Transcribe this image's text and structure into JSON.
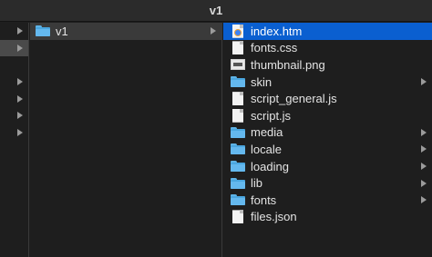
{
  "window": {
    "title": "v1"
  },
  "column1": {
    "rows": 12,
    "arrow_rows": [
      0,
      1,
      3,
      4,
      5,
      6
    ]
  },
  "column2": {
    "items": [
      {
        "name": "v1",
        "type": "folder",
        "selected": true,
        "has_children": true
      }
    ]
  },
  "column3": {
    "items": [
      {
        "name": "index.htm",
        "type": "html",
        "selected": true,
        "has_children": false
      },
      {
        "name": "fonts.css",
        "type": "file",
        "selected": false,
        "has_children": false
      },
      {
        "name": "thumbnail.png",
        "type": "image",
        "selected": false,
        "has_children": false
      },
      {
        "name": "skin",
        "type": "folder",
        "selected": false,
        "has_children": true
      },
      {
        "name": "script_general.js",
        "type": "file",
        "selected": false,
        "has_children": false
      },
      {
        "name": "script.js",
        "type": "file",
        "selected": false,
        "has_children": false
      },
      {
        "name": "media",
        "type": "folder",
        "selected": false,
        "has_children": true
      },
      {
        "name": "locale",
        "type": "folder",
        "selected": false,
        "has_children": true
      },
      {
        "name": "loading",
        "type": "folder",
        "selected": false,
        "has_children": true
      },
      {
        "name": "lib",
        "type": "folder",
        "selected": false,
        "has_children": true
      },
      {
        "name": "fonts",
        "type": "folder",
        "selected": false,
        "has_children": true
      },
      {
        "name": "files.json",
        "type": "file",
        "selected": false,
        "has_children": false
      }
    ]
  },
  "colors": {
    "selection": "#0a5fd0",
    "folder": "#4aa6df",
    "background": "#1e1e1e"
  }
}
